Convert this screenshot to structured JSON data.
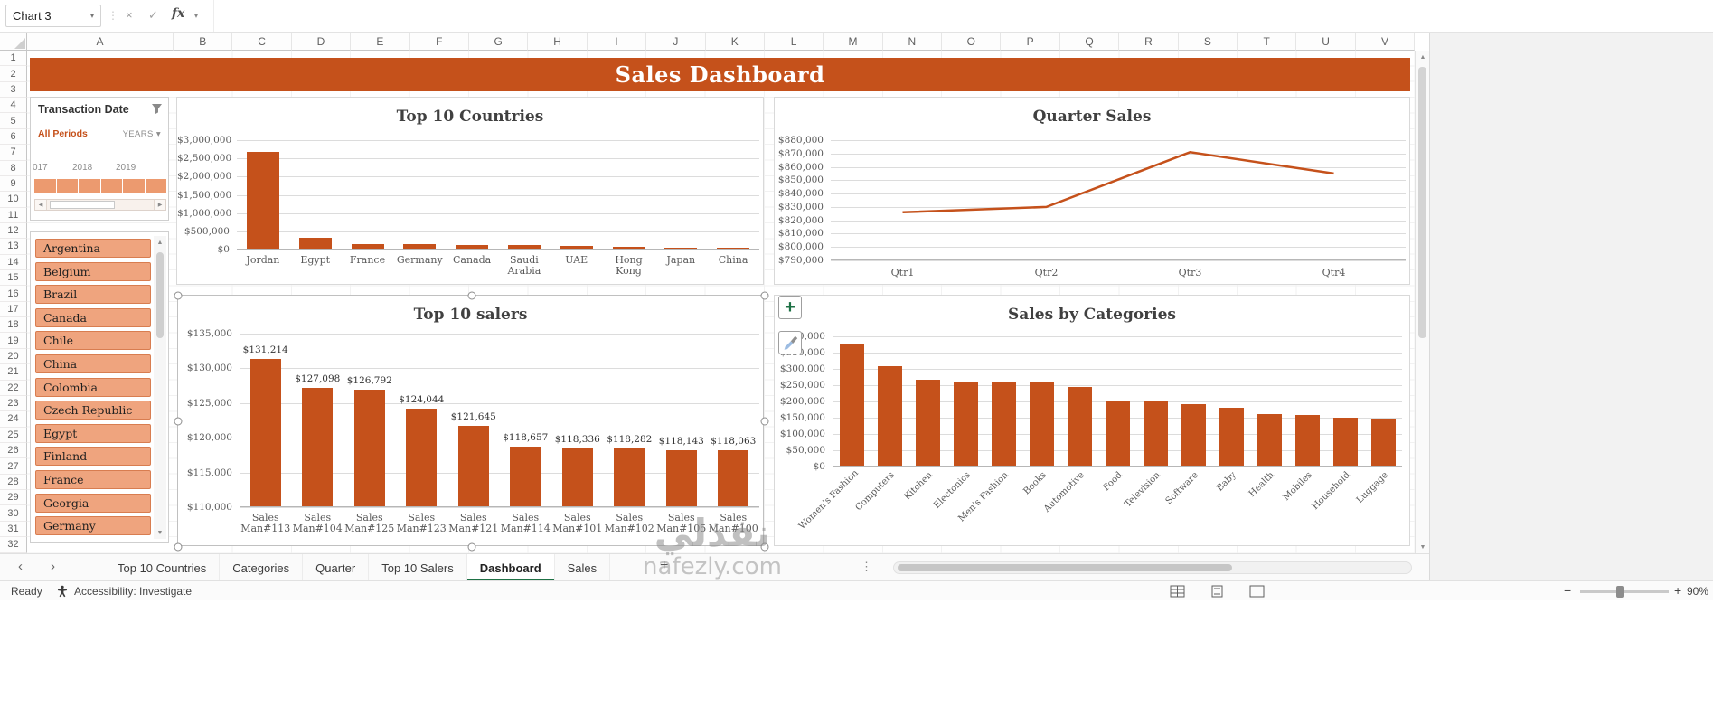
{
  "colors": {
    "accent": "#C5511B",
    "banner": "#C5511B",
    "slicer_fill": "#EFA47E",
    "slicer_border": "#D87D50",
    "timeline_fill": "#EC9A6F",
    "tab_active_underline": "#1E7145"
  },
  "formula_bar": {
    "name_box": "Chart 3",
    "cancel": "×",
    "enter": "✓",
    "fx": "fx"
  },
  "grid": {
    "columns": [
      "A",
      "B",
      "C",
      "D",
      "E",
      "F",
      "G",
      "H",
      "I",
      "J",
      "K",
      "L",
      "M",
      "N",
      "O",
      "P",
      "Q",
      "R",
      "S",
      "T",
      "U",
      "V"
    ],
    "rows": [
      1,
      2,
      3,
      4,
      5,
      6,
      7,
      8,
      9,
      10,
      11,
      12,
      13,
      14,
      15,
      16,
      17,
      18,
      19,
      20,
      21,
      22,
      23,
      24,
      25,
      26,
      27,
      28,
      29,
      30,
      31,
      32
    ]
  },
  "banner": {
    "title": "Sales Dashboard"
  },
  "timeline": {
    "title": "Transaction Date",
    "period_label": "All Periods",
    "level_label": "YEARS",
    "years": [
      "017",
      "2018",
      "2019"
    ]
  },
  "country_slicer": {
    "items": [
      "Argentina",
      "Belgium",
      "Brazil",
      "Canada",
      "Chile",
      "China",
      "Colombia",
      "Czech Republic",
      "Egypt",
      "Finland",
      "France",
      "Georgia",
      "Germany"
    ]
  },
  "chart_data": [
    {
      "id": "top10_countries",
      "type": "bar",
      "title": "Top 10 Countries",
      "categories": [
        "Jordan",
        "Egypt",
        "France",
        "Germany",
        "Canada",
        "Saudi Arabia",
        "UAE",
        "Hong Kong",
        "Japan",
        "China"
      ],
      "values": [
        2650000,
        300000,
        130000,
        115000,
        100000,
        90000,
        70000,
        50000,
        30000,
        20000
      ],
      "ylim": [
        0,
        3000000
      ],
      "yticks": [
        "$3,000,000",
        "$2,500,000",
        "$2,000,000",
        "$1,500,000",
        "$1,000,000",
        "$500,000",
        "$0"
      ],
      "xlabel": "",
      "ylabel": "",
      "legend": "none",
      "grid": true
    },
    {
      "id": "quarter_sales",
      "type": "line",
      "title": "Quarter Sales",
      "categories": [
        "Qtr1",
        "Qtr2",
        "Qtr3",
        "Qtr4"
      ],
      "values": [
        826000,
        830000,
        871000,
        855000
      ],
      "ylim": [
        790000,
        880000
      ],
      "yticks": [
        "$880,000",
        "$870,000",
        "$860,000",
        "$850,000",
        "$840,000",
        "$830,000",
        "$820,000",
        "$810,000",
        "$800,000",
        "$790,000"
      ],
      "xlabel": "",
      "ylabel": "",
      "legend": "none",
      "grid": true
    },
    {
      "id": "top10_salers",
      "type": "bar",
      "title": "Top 10 salers",
      "categories": [
        "Sales Man#113",
        "Sales Man#104",
        "Sales Man#125",
        "Sales Man#123",
        "Sales Man#121",
        "Sales Man#114",
        "Sales Man#101",
        "Sales Man#102",
        "Sales Man#105",
        "Sales Man#100"
      ],
      "values": [
        131214,
        127098,
        126792,
        124044,
        121645,
        118657,
        118336,
        118282,
        118143,
        118063
      ],
      "data_labels": [
        "$131,214",
        "$127,098",
        "$126,792",
        "$124,044",
        "$121,645",
        "$118,657",
        "$118,336",
        "$118,282",
        "$118,143",
        "$118,063"
      ],
      "ylim": [
        110000,
        135000
      ],
      "yticks": [
        "$135,000",
        "$130,000",
        "$125,000",
        "$120,000",
        "$115,000",
        "$110,000"
      ],
      "xlabel": "",
      "ylabel": "",
      "legend": "none",
      "grid": true,
      "selected": true
    },
    {
      "id": "sales_by_categories",
      "type": "bar",
      "title": "Sales by Categories",
      "categories": [
        "Women's Fashion",
        "Computers",
        "Kitchen",
        "Electonics",
        "Men's Fashion",
        "Books",
        "Automotive",
        "Food",
        "Television",
        "Software",
        "Baby",
        "Health",
        "Mobiles",
        "Household",
        "Luggage"
      ],
      "values": [
        375000,
        305000,
        265000,
        258000,
        257000,
        255000,
        243000,
        201000,
        200000,
        190000,
        178000,
        159000,
        157000,
        148000,
        145000
      ],
      "ylim": [
        0,
        400000
      ],
      "yticks": [
        "$400,000",
        "$350,000",
        "$300,000",
        "$250,000",
        "$200,000",
        "$150,000",
        "$100,000",
        "$50,000",
        "$0"
      ],
      "xlabel": "",
      "ylabel": "",
      "legend": "none",
      "grid": true
    }
  ],
  "sheet_tabs": {
    "tabs": [
      {
        "label": "Top 10 Countries",
        "active": false
      },
      {
        "label": "Categories",
        "active": false
      },
      {
        "label": "Quarter",
        "active": false
      },
      {
        "label": "Top 10 Salers",
        "active": false
      },
      {
        "label": "Dashboard",
        "active": true
      },
      {
        "label": "Sales",
        "active": false
      }
    ],
    "add_label": "+"
  },
  "status_bar": {
    "ready": "Ready",
    "accessibility": "Accessibility: Investigate",
    "zoom": "90%"
  },
  "watermark": {
    "arabic": "نفذلي",
    "latin": "nafezly.com"
  }
}
